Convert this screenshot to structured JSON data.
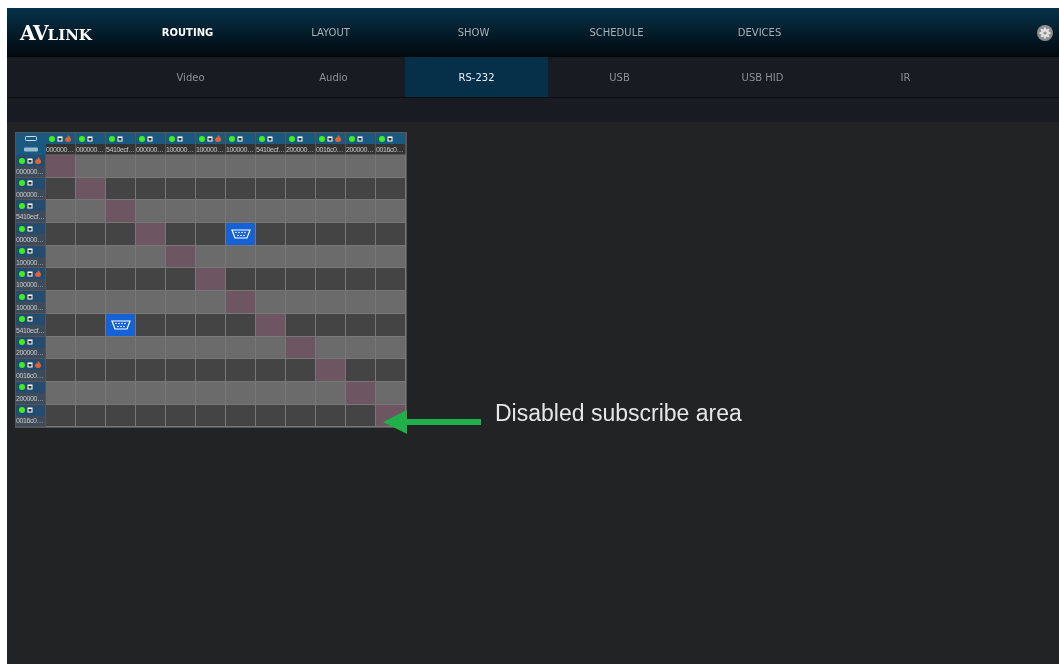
{
  "logo": {
    "big": "AV",
    "small": "LINK"
  },
  "nav": [
    {
      "label": "ROUTING",
      "selected": true
    },
    {
      "label": "LAYOUT",
      "selected": false
    },
    {
      "label": "SHOW",
      "selected": false
    },
    {
      "label": "SCHEDULE",
      "selected": false
    },
    {
      "label": "DEVICES",
      "selected": false
    }
  ],
  "subtabs": [
    {
      "label": "Video",
      "selected": false
    },
    {
      "label": "Audio",
      "selected": false
    },
    {
      "label": "RS-232",
      "selected": true
    },
    {
      "label": "USB",
      "selected": false
    },
    {
      "label": "USB HID",
      "selected": false
    },
    {
      "label": "IR",
      "selected": false
    }
  ],
  "matrix": {
    "columns": [
      {
        "label": "000000…",
        "online": true,
        "alert": true
      },
      {
        "label": "000000…",
        "online": true,
        "alert": false
      },
      {
        "label": "5410ecf…",
        "online": true,
        "alert": false
      },
      {
        "label": "000000…",
        "online": true,
        "alert": false
      },
      {
        "label": "100000…",
        "online": true,
        "alert": false
      },
      {
        "label": "100000…",
        "online": true,
        "alert": true
      },
      {
        "label": "100000…",
        "online": true,
        "alert": false
      },
      {
        "label": "5410ecf…",
        "online": true,
        "alert": false
      },
      {
        "label": "200000…",
        "online": true,
        "alert": false
      },
      {
        "label": "0016c0…",
        "online": true,
        "alert": true
      },
      {
        "label": "200000…",
        "online": true,
        "alert": false
      },
      {
        "label": "0016c0…",
        "online": true,
        "alert": false
      }
    ],
    "rows": [
      {
        "label": "000000…",
        "online": true,
        "alert": true,
        "cells": [
          {
            "kind": "disabled"
          },
          {
            "kind": "open"
          },
          {
            "kind": "open"
          },
          {
            "kind": "open"
          },
          {
            "kind": "open"
          },
          {
            "kind": "open"
          },
          {
            "kind": "open"
          },
          {
            "kind": "open"
          },
          {
            "kind": "open"
          },
          {
            "kind": "open"
          },
          {
            "kind": "open"
          },
          {
            "kind": "open"
          }
        ]
      },
      {
        "label": "000000…",
        "online": true,
        "alert": false,
        "cells": [
          {
            "kind": "open"
          },
          {
            "kind": "disabled"
          },
          {
            "kind": "open"
          },
          {
            "kind": "open"
          },
          {
            "kind": "open"
          },
          {
            "kind": "open"
          },
          {
            "kind": "open"
          },
          {
            "kind": "open"
          },
          {
            "kind": "open"
          },
          {
            "kind": "open"
          },
          {
            "kind": "open"
          },
          {
            "kind": "open"
          }
        ]
      },
      {
        "label": "5410ecf…",
        "online": true,
        "alert": false,
        "cells": [
          {
            "kind": "open"
          },
          {
            "kind": "open"
          },
          {
            "kind": "disabled"
          },
          {
            "kind": "open"
          },
          {
            "kind": "open"
          },
          {
            "kind": "open"
          },
          {
            "kind": "open"
          },
          {
            "kind": "open"
          },
          {
            "kind": "open"
          },
          {
            "kind": "open"
          },
          {
            "kind": "open"
          },
          {
            "kind": "open"
          }
        ]
      },
      {
        "label": "000000…",
        "online": true,
        "alert": false,
        "cells": [
          {
            "kind": "open"
          },
          {
            "kind": "open"
          },
          {
            "kind": "open"
          },
          {
            "kind": "disabled"
          },
          {
            "kind": "open"
          },
          {
            "kind": "open"
          },
          {
            "kind": "routed"
          },
          {
            "kind": "open"
          },
          {
            "kind": "open"
          },
          {
            "kind": "open"
          },
          {
            "kind": "open"
          },
          {
            "kind": "open"
          }
        ]
      },
      {
        "label": "100000…",
        "online": true,
        "alert": false,
        "cells": [
          {
            "kind": "open"
          },
          {
            "kind": "open"
          },
          {
            "kind": "open"
          },
          {
            "kind": "open"
          },
          {
            "kind": "disabled"
          },
          {
            "kind": "open"
          },
          {
            "kind": "open"
          },
          {
            "kind": "open"
          },
          {
            "kind": "open"
          },
          {
            "kind": "open"
          },
          {
            "kind": "open"
          },
          {
            "kind": "open"
          }
        ]
      },
      {
        "label": "100000…",
        "online": true,
        "alert": true,
        "cells": [
          {
            "kind": "open"
          },
          {
            "kind": "open"
          },
          {
            "kind": "open"
          },
          {
            "kind": "open"
          },
          {
            "kind": "open"
          },
          {
            "kind": "disabled"
          },
          {
            "kind": "open"
          },
          {
            "kind": "open"
          },
          {
            "kind": "open"
          },
          {
            "kind": "open"
          },
          {
            "kind": "open"
          },
          {
            "kind": "open"
          }
        ]
      },
      {
        "label": "100000…",
        "online": true,
        "alert": false,
        "cells": [
          {
            "kind": "open"
          },
          {
            "kind": "open"
          },
          {
            "kind": "open"
          },
          {
            "kind": "open"
          },
          {
            "kind": "open"
          },
          {
            "kind": "open"
          },
          {
            "kind": "disabled"
          },
          {
            "kind": "open"
          },
          {
            "kind": "open"
          },
          {
            "kind": "open"
          },
          {
            "kind": "open"
          },
          {
            "kind": "open"
          }
        ]
      },
      {
        "label": "5410ecf…",
        "online": true,
        "alert": false,
        "cells": [
          {
            "kind": "open"
          },
          {
            "kind": "open"
          },
          {
            "kind": "routed"
          },
          {
            "kind": "open"
          },
          {
            "kind": "open"
          },
          {
            "kind": "open"
          },
          {
            "kind": "open"
          },
          {
            "kind": "disabled"
          },
          {
            "kind": "open"
          },
          {
            "kind": "open"
          },
          {
            "kind": "open"
          },
          {
            "kind": "open"
          }
        ]
      },
      {
        "label": "200000…",
        "online": true,
        "alert": false,
        "cells": [
          {
            "kind": "open"
          },
          {
            "kind": "open"
          },
          {
            "kind": "open"
          },
          {
            "kind": "open"
          },
          {
            "kind": "open"
          },
          {
            "kind": "open"
          },
          {
            "kind": "open"
          },
          {
            "kind": "open"
          },
          {
            "kind": "disabled"
          },
          {
            "kind": "open"
          },
          {
            "kind": "open"
          },
          {
            "kind": "open"
          }
        ]
      },
      {
        "label": "0016c0…",
        "online": true,
        "alert": true,
        "cells": [
          {
            "kind": "open"
          },
          {
            "kind": "open"
          },
          {
            "kind": "open"
          },
          {
            "kind": "open"
          },
          {
            "kind": "open"
          },
          {
            "kind": "open"
          },
          {
            "kind": "open"
          },
          {
            "kind": "open"
          },
          {
            "kind": "open"
          },
          {
            "kind": "disabled"
          },
          {
            "kind": "open"
          },
          {
            "kind": "open"
          }
        ]
      },
      {
        "label": "200000…",
        "online": true,
        "alert": false,
        "cells": [
          {
            "kind": "open"
          },
          {
            "kind": "open"
          },
          {
            "kind": "open"
          },
          {
            "kind": "open"
          },
          {
            "kind": "open"
          },
          {
            "kind": "open"
          },
          {
            "kind": "open"
          },
          {
            "kind": "open"
          },
          {
            "kind": "open"
          },
          {
            "kind": "open"
          },
          {
            "kind": "disabled"
          },
          {
            "kind": "open"
          }
        ]
      },
      {
        "label": "0016c0…",
        "online": true,
        "alert": false,
        "cells": [
          {
            "kind": "open"
          },
          {
            "kind": "open"
          },
          {
            "kind": "open"
          },
          {
            "kind": "open"
          },
          {
            "kind": "open"
          },
          {
            "kind": "open"
          },
          {
            "kind": "open"
          },
          {
            "kind": "open"
          },
          {
            "kind": "open"
          },
          {
            "kind": "open"
          },
          {
            "kind": "open"
          },
          {
            "kind": "disabled"
          }
        ]
      }
    ]
  },
  "annotation": {
    "text": "Disabled subscribe area"
  }
}
